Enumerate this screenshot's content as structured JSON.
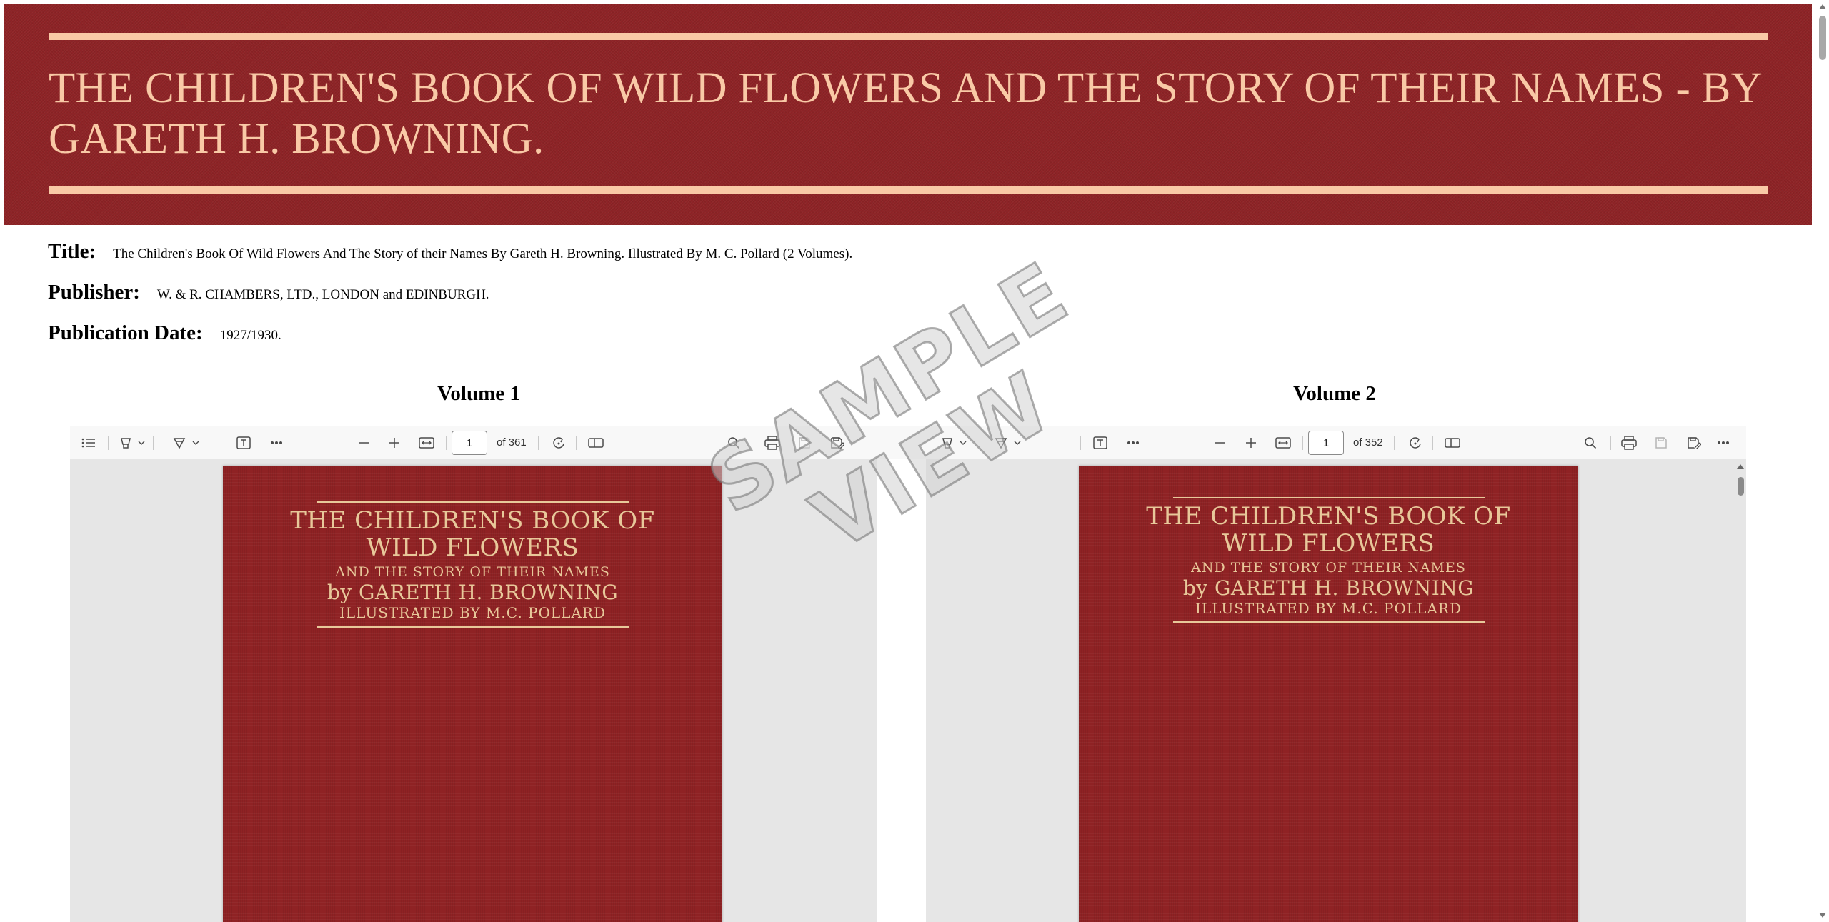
{
  "banner": {
    "title": "THE CHILDREN'S BOOK OF WILD FLOWERS AND THE STORY OF THEIR NAMES - BY GARETH H. BROWNING."
  },
  "meta": {
    "title_label": "Title:",
    "title_value": "The Children's Book Of Wild Flowers And The Story of their Names By Gareth H. Browning. Illustrated By M. C. Pollard (2 Volumes).",
    "publisher_label": "Publisher:",
    "publisher_value": "W. & R. CHAMBERS, LTD., LONDON and EDINBURGH.",
    "date_label": "Publication Date:",
    "date_value": "1927/1930."
  },
  "volumes": [
    {
      "heading": "Volume 1",
      "page_value": "1",
      "page_count": "of 361",
      "cover": {
        "line1": "THE CHILDREN'S BOOK OF",
        "line2": "WILD FLOWERS",
        "line3": "AND THE STORY OF THEIR NAMES",
        "line4": "by  GARETH H. BROWNING",
        "line5": "ILLUSTRATED BY M.C. POLLARD"
      }
    },
    {
      "heading": "Volume 2",
      "page_value": "1",
      "page_count": "of 352",
      "cover": {
        "line1": "THE CHILDREN'S BOOK OF",
        "line2": "WILD FLOWERS",
        "line3": "AND THE STORY OF THEIR NAMES",
        "line4": "by  GARETH H. BROWNING",
        "line5": "ILLUSTRATED BY M.C. POLLARD"
      }
    }
  ],
  "watermark": {
    "line1": "SAMPLE",
    "line2": "VIEW"
  },
  "colors": {
    "banner_bg": "#8e2326",
    "banner_text": "#f9c9a6",
    "cover_bg": "#8f2224",
    "cover_text": "#e8c89a",
    "viewer_bg": "#e6e6e6"
  },
  "icons": {
    "toolbar": [
      "contents-icon",
      "highlight-icon",
      "draw-icon",
      "text-icon",
      "more-icon",
      "zoom-out-icon",
      "zoom-in-icon",
      "fit-width-icon",
      "rotate-icon",
      "page-view-icon",
      "search-icon",
      "print-icon",
      "save-icon",
      "save-as-icon"
    ]
  }
}
